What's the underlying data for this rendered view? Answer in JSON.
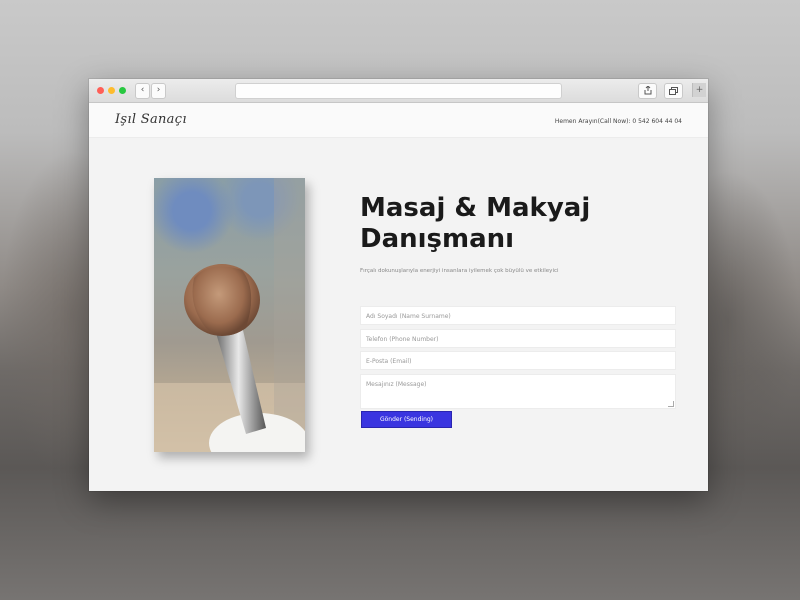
{
  "header": {
    "logo": "Işıl Sanaçı",
    "phone": "Hemen Arayın(Call Now): 0 542 604 44 04"
  },
  "browser": {
    "back_glyph": "‹",
    "forward_glyph": "›",
    "share_icon": "share-icon",
    "tabs_icon": "tabs-icon",
    "new_tab_glyph": "+"
  },
  "hero": {
    "title": "Masaj & Makyaj Danışmanı",
    "subtitle": "Fırçalı dokunuşlarıyla enerjiyi insanlara iyilemek çok büyülü ve etkileyici"
  },
  "form": {
    "name_placeholder": "Adı Soyadı (Name Surname)",
    "phone_placeholder": "Telefon (Phone Number)",
    "email_placeholder": "E-Posta (Email)",
    "message_placeholder": "Mesajınız (Message)",
    "send_label": "Gönder (Sending)"
  },
  "colors": {
    "accent": "#3a35e0"
  }
}
